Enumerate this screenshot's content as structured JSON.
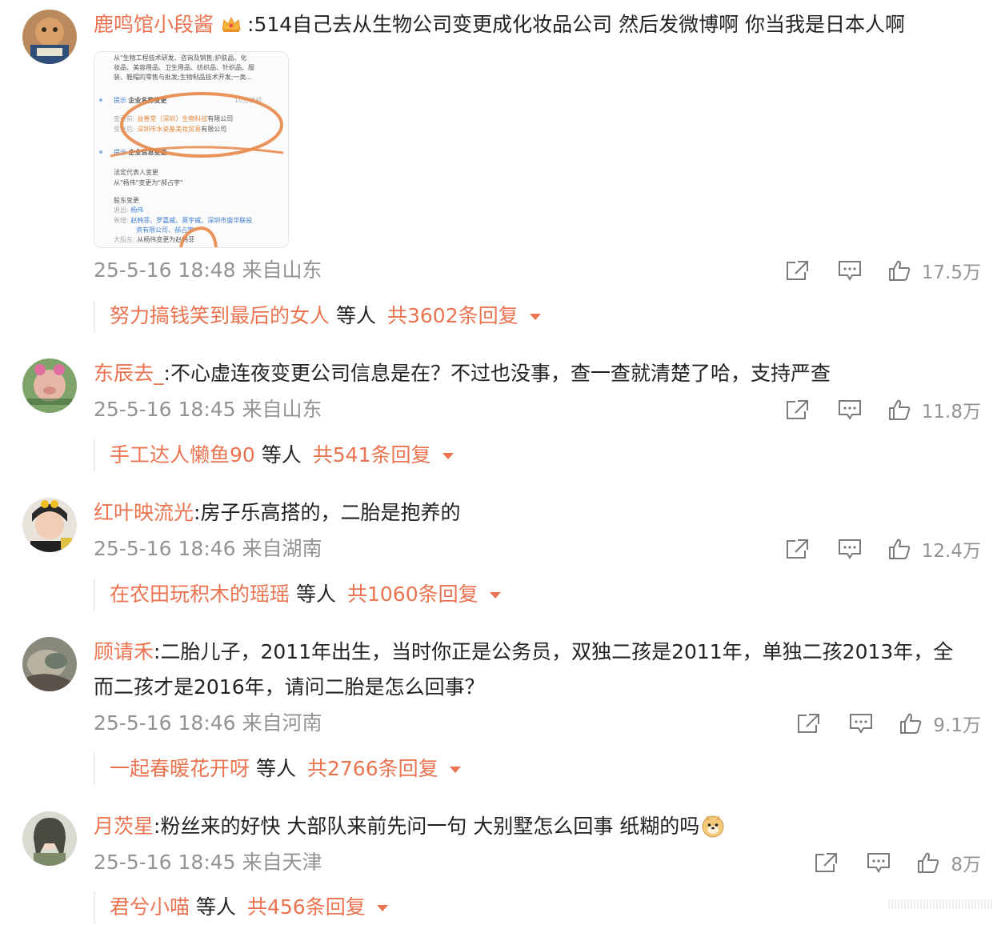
{
  "comments": [
    {
      "name": "鹿鸣馆小段酱",
      "text": ":514自己去从生物公司变更成化妆品公司 然后发微博啊 你当我是日本人啊",
      "time": "25-5-16 18:48",
      "location": "来自山东",
      "likes": "17.5万",
      "reply_user": "努力搞钱笑到最后的女人",
      "reply_mid": "等人",
      "reply_total": "共3602条回复",
      "image": {
        "top_lines": [
          "从\"生物工程技术研发、咨询及销售;护肤品、化",
          "妆品、美容用品、卫生用品、纺织品、针织品、服",
          "装、鞋帽的零售与批发;生物制品技术开发;一类..."
        ],
        "tag1": "提示",
        "title1": "企业名称变更",
        "time1": "10分钟前",
        "before_label": "变更前:",
        "before_value": "益善堂（深圳）生物科技",
        "before_suffix": "有限公司",
        "after_label": "变更后:",
        "after_value": "深圳市水瓷基美妆贸易",
        "after_suffix": "有限公司",
        "tag2": "提示",
        "title2": "企业信息变更",
        "legal_title": "法定代表人变更",
        "legal_text": "从\"杨伟\"变更为\"郝占宇\"",
        "holder_title": "股东变更",
        "exit_label": "退出:",
        "exit_value": "杨伟",
        "add_label": "新增:",
        "add_value": "赵韩菲、罗嘉威、莫宇威、",
        "add_value2": "深圳市盛华联投",
        "add_value3": "资有限公司、郝占宇",
        "major_label": "大股东:",
        "major_value": "从杨伟变更为赵韩菲"
      }
    },
    {
      "name": "东辰去_",
      "text": ":不心虚连夜变更公司信息是在？不过也没事，查一查就清楚了哈，支持严查",
      "time": "25-5-16 18:45",
      "location": "来自山东",
      "likes": "11.8万",
      "reply_user": "手工达人懒鱼90",
      "reply_mid": "等人",
      "reply_total": "共541条回复"
    },
    {
      "name": "红叶映流光",
      "text": ":房子乐高搭的，二胎是抱养的",
      "time": "25-5-16 18:46",
      "location": "来自湖南",
      "likes": "12.4万",
      "reply_user": "在农田玩积木的瑶瑶",
      "reply_mid": "等人",
      "reply_total": "共1060条回复"
    },
    {
      "name": "顾请禾",
      "text": ":二胎儿子，2011年出生，当时你正是公务员，双独二孩是2011年，单独二孩2013年，全",
      "text2": "而二孩才是2016年，请问二胎是怎么回事？",
      "time": "25-5-16 18:46",
      "location": "来自河南",
      "likes": "9.1万",
      "reply_user": "一起春暖花开呀",
      "reply_mid": "等人",
      "reply_total": "共2766条回复"
    },
    {
      "name": "月茨星",
      "text": ":粉丝来的好快 大部队来前先问一句 大别墅怎么回事 纸糊的吗",
      "time": "25-5-16 18:45",
      "location": "来自天津",
      "likes": "8万",
      "reply_user": "君兮小喵",
      "reply_mid": "等人",
      "reply_total": "共456条回复"
    }
  ],
  "colors": {
    "accent": "#eb7350",
    "meta": "#939393",
    "link": "#3f7fd1"
  },
  "icons": [
    "crown-badge-icon",
    "share-icon",
    "comment-icon",
    "like-icon",
    "caret-down-icon",
    "doge-emoji-icon"
  ]
}
